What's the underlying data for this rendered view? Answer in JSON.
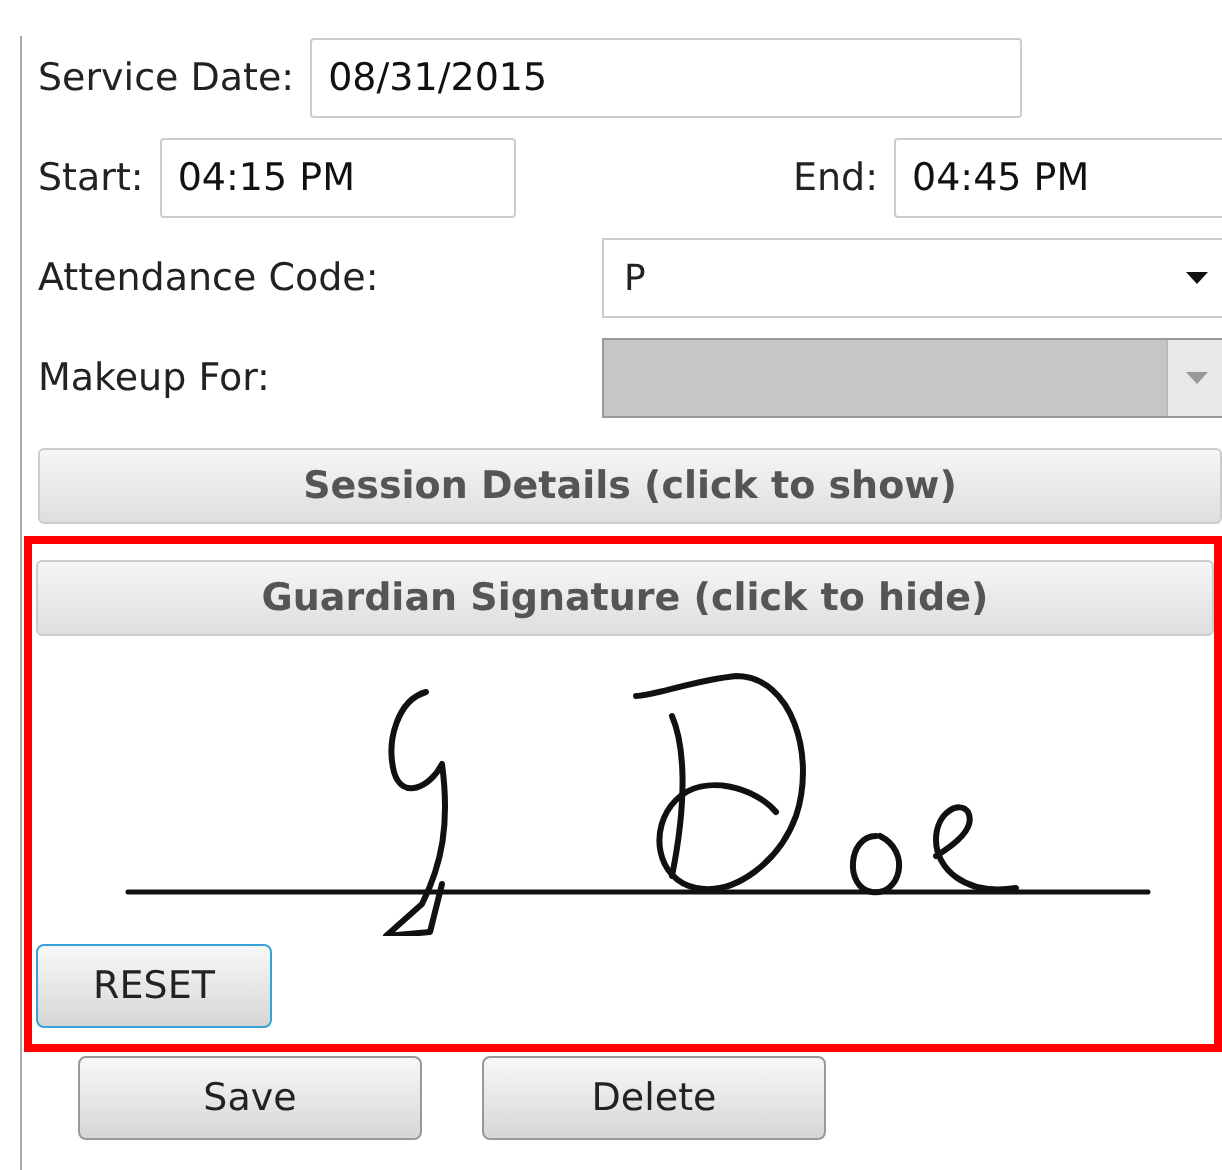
{
  "form": {
    "service_date": {
      "label": "Service Date:",
      "value": "08/31/2015"
    },
    "start": {
      "label": "Start:",
      "value": "04:15 PM"
    },
    "end": {
      "label": "End:",
      "value": "04:45 PM"
    },
    "selects": [
      {
        "label": "Attendance Code:",
        "value": "P",
        "disabled": false
      },
      {
        "label": "Makeup For:",
        "disabled": true
      }
    ]
  },
  "panels": [
    {
      "title": "Session Details (click to show)",
      "expanded": false,
      "highlighted": false
    },
    {
      "title": "Guardian Signature (click to hide)",
      "expanded": true,
      "highlighted": true,
      "reset": "RESET"
    }
  ],
  "buttons": [
    "Save",
    "Delete"
  ]
}
